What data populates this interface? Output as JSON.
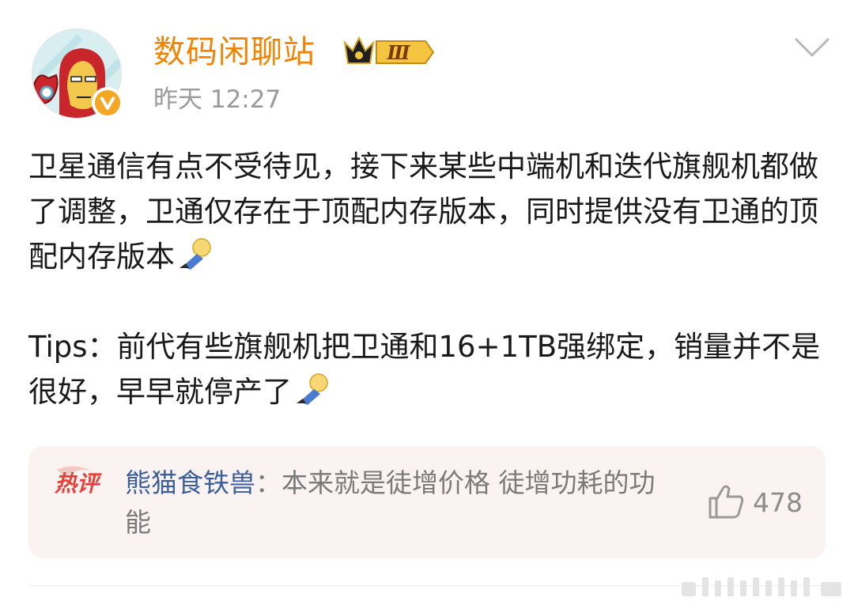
{
  "author": {
    "name": "数码闲聊站",
    "vip_level": "Ⅲ",
    "verified_badge": "v",
    "time": "昨天 12:27"
  },
  "post": {
    "paragraphs": [
      "卫星通信有点不受待见，接下来某些中端机和迭代旗舰机都做了调整，卫通仅存在于顶配内存版本，同时提供没有卫通的顶配内存版本",
      "Tips：前代有些旗舰机把卫通和16+1TB强绑定，销量并不是很好，早早就停产了"
    ],
    "emoji": "doge-lying-emoji"
  },
  "hot_comment": {
    "tag": "热评",
    "commenter": "熊猫食铁兽",
    "separator": "：",
    "text": "本来就是徒增价格 徒增功耗的功能",
    "likes": "478"
  },
  "colors": {
    "username": "#f08300",
    "commenter": "#3b5f9b",
    "hot_tag": "#e8413a",
    "comment_bg": "#fbf3f2"
  }
}
